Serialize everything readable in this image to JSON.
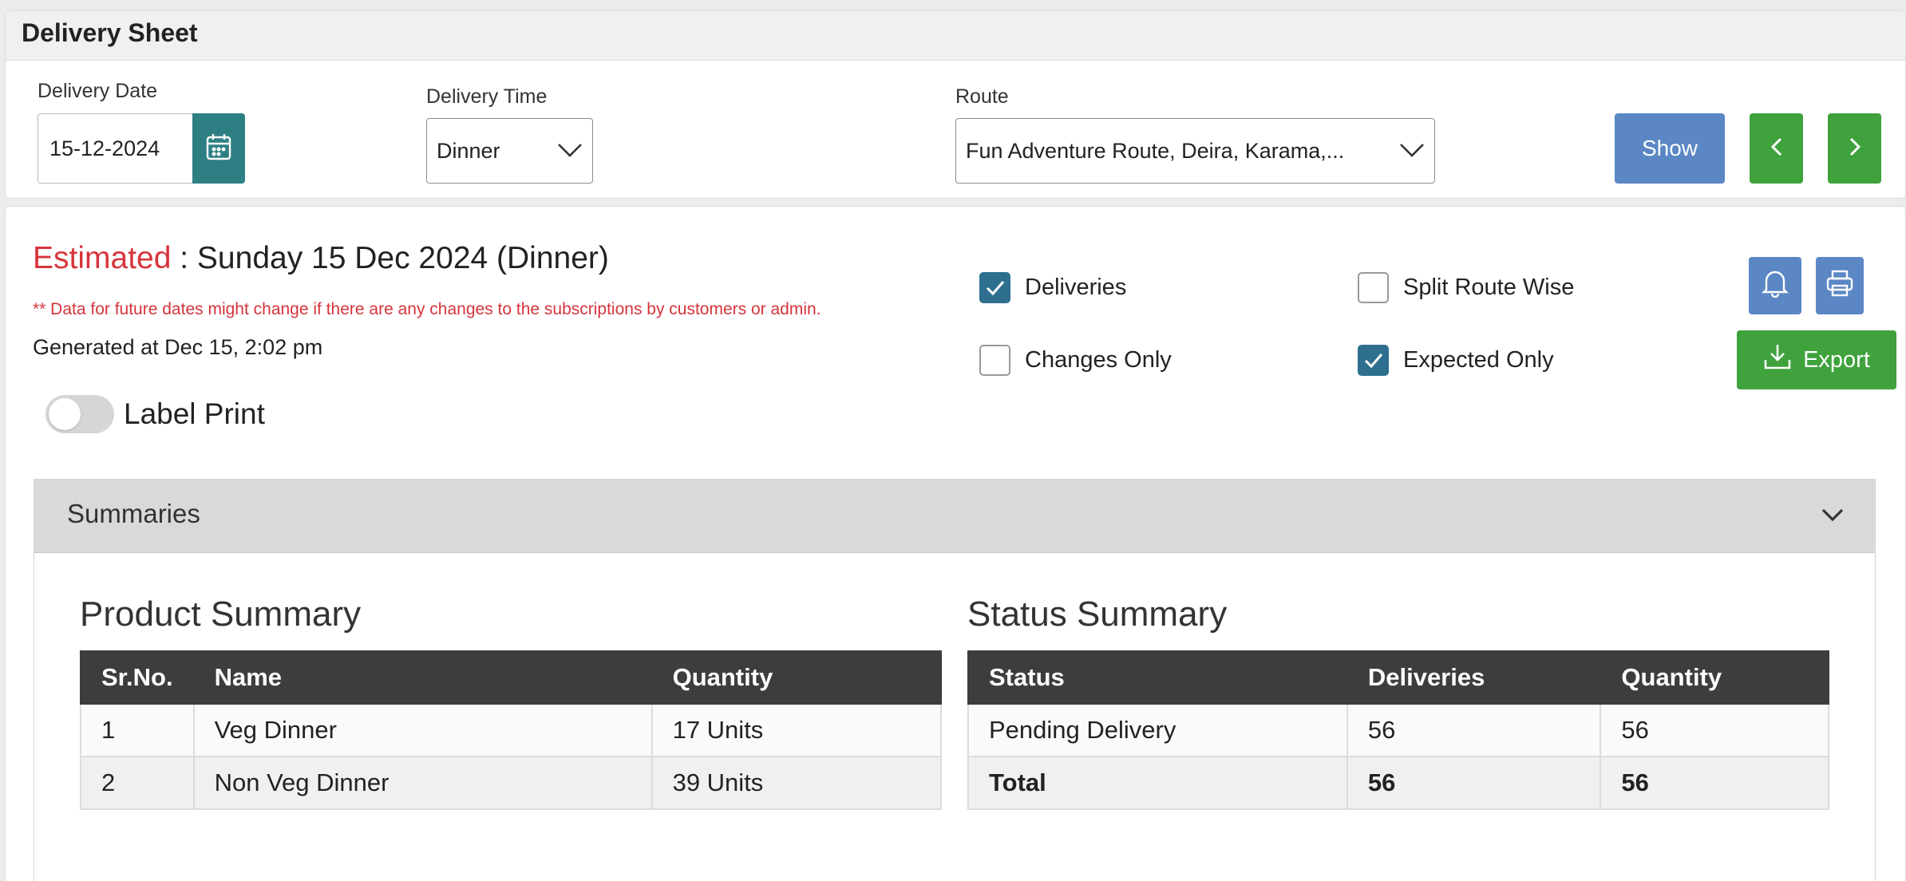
{
  "page": {
    "title": "Delivery Sheet"
  },
  "filters": {
    "delivery_date": {
      "label": "Delivery Date",
      "value": "15-12-2024"
    },
    "delivery_time": {
      "label": "Delivery Time",
      "value": "Dinner"
    },
    "route": {
      "label": "Route",
      "value": "Fun Adventure Route, Deira, Karama,..."
    },
    "show_label": "Show"
  },
  "estimate": {
    "estimated_word": "Estimated",
    "separator": " : ",
    "date_text": "Sunday 15 Dec 2024 (Dinner)",
    "warning": "** Data for future dates might change if there are any changes to the subscriptions by customers or admin.",
    "generated": "Generated at Dec 15, 2:02 pm"
  },
  "options": {
    "deliveries": {
      "label": "Deliveries",
      "checked": true
    },
    "split_route_wise": {
      "label": "Split Route Wise",
      "checked": false
    },
    "changes_only": {
      "label": "Changes Only",
      "checked": false
    },
    "expected_only": {
      "label": "Expected Only",
      "checked": true
    }
  },
  "label_print": {
    "label": "Label Print",
    "on": false
  },
  "export_label": "Export",
  "summaries": {
    "title": "Summaries",
    "product_summary": {
      "title": "Product Summary",
      "columns": [
        "Sr.No.",
        "Name",
        "Quantity"
      ],
      "rows": [
        {
          "sr": "1",
          "name": "Veg Dinner",
          "quantity": "17 Units"
        },
        {
          "sr": "2",
          "name": "Non Veg Dinner",
          "quantity": "39 Units"
        }
      ]
    },
    "status_summary": {
      "title": "Status Summary",
      "columns": [
        "Status",
        "Deliveries",
        "Quantity"
      ],
      "rows": [
        {
          "status": "Pending Delivery",
          "deliveries": "56",
          "quantity": "56"
        },
        {
          "status": "Total",
          "deliveries": "56",
          "quantity": "56"
        }
      ]
    }
  },
  "colors": {
    "accent_red": "#d6343c",
    "teal": "#2e7f83",
    "blue_button": "#5b87c5",
    "green_button": "#3fa23d",
    "table_header": "#3d3d3d"
  }
}
